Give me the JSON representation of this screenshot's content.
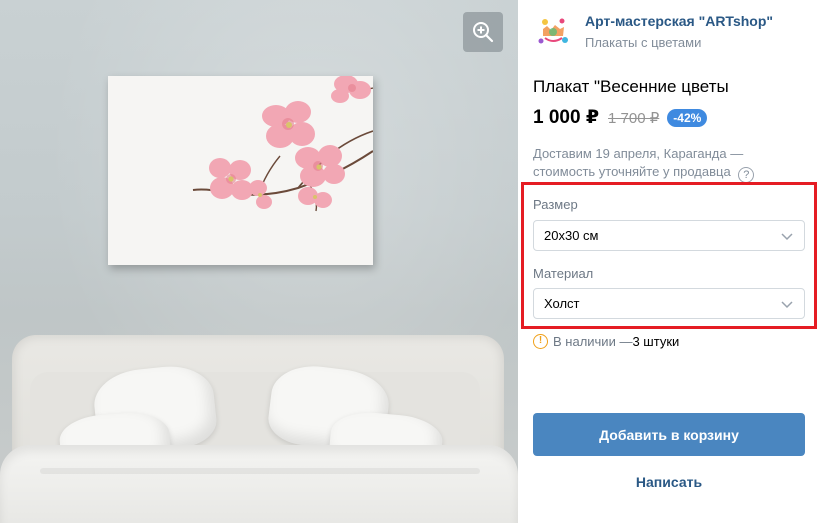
{
  "shop": {
    "name": "Арт-мастерская \"ARTshop\"",
    "subtitle": "Плакаты с цветами",
    "logo_icon": "artshop-logo"
  },
  "product": {
    "title": "Плакат \"Весенние цветы",
    "price": "1 000 ₽",
    "old_price": "1 700 ₽",
    "discount": "-42%"
  },
  "delivery": {
    "text": "Доставим 19 апреля, Караганда — стоимость уточняйте у продавца",
    "help_icon": "question-icon",
    "help_glyph": "?"
  },
  "options": {
    "size_label": "Размер",
    "size_value": "20x30 см",
    "material_label": "Материал",
    "material_value": "Холст"
  },
  "stock": {
    "prefix": "В наличии — ",
    "count": "3 штуки",
    "icon": "exclamation-circle-icon",
    "icon_glyph": "!"
  },
  "actions": {
    "add_to_cart": "Добавить в корзину",
    "write": "Написать"
  },
  "image": {
    "zoom_icon": "zoom-in-icon"
  },
  "colors": {
    "accent": "#4a86c0",
    "link": "#2a5885",
    "discount": "#3f8ae0",
    "highlight_border": "#e51c23",
    "warning": "#f0a11a"
  }
}
